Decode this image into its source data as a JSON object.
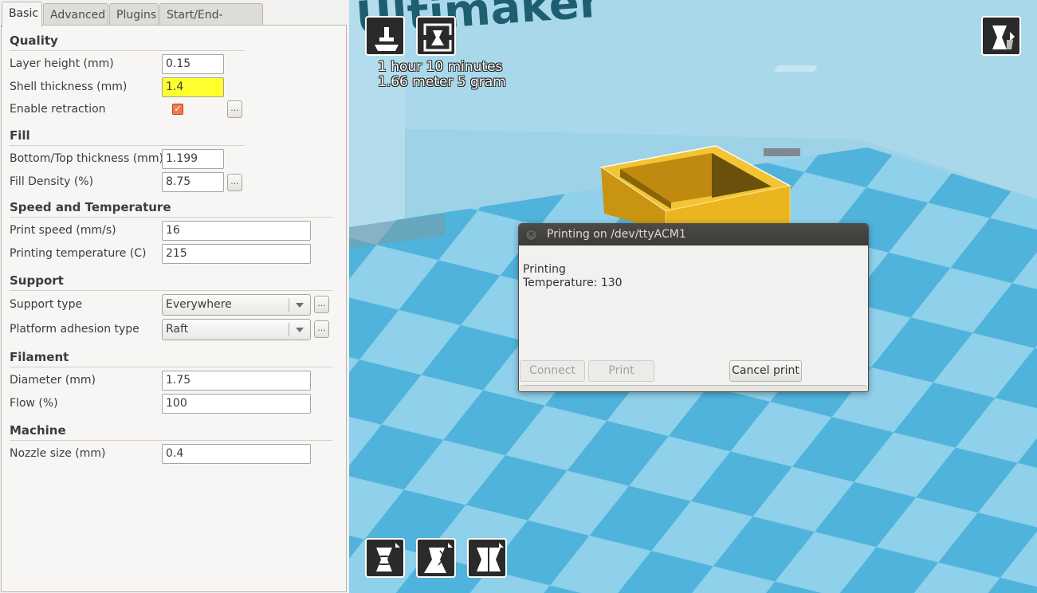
{
  "tabs": [
    "Basic",
    "Advanced",
    "Plugins",
    "Start/End-GCode"
  ],
  "quality": {
    "heading": "Quality",
    "layer_height_label": "Layer height (mm)",
    "layer_height": "0.15",
    "shell_label": "Shell thickness (mm)",
    "shell": "1.4",
    "retraction_label": "Enable retraction",
    "retraction_checked": true
  },
  "fill": {
    "heading": "Fill",
    "bottom_top_label": "Bottom/Top thickness (mm)",
    "bottom_top": "1.199",
    "density_label": "Fill Density (%)",
    "density": "8.75"
  },
  "speed": {
    "heading": "Speed and Temperature",
    "print_speed_label": "Print speed (mm/s)",
    "print_speed": "16",
    "temp_label": "Printing temperature (C)",
    "temp": "215"
  },
  "support": {
    "heading": "Support",
    "type_label": "Support type",
    "type": "Everywhere",
    "adhesion_label": "Platform adhesion type",
    "adhesion": "Raft"
  },
  "filament": {
    "heading": "Filament",
    "diameter_label": "Diameter (mm)",
    "diameter": "1.75",
    "flow_label": "Flow (%)",
    "flow": "100"
  },
  "machine": {
    "heading": "Machine",
    "nozzle_label": "Nozzle size (mm)",
    "nozzle": "0.4"
  },
  "dots_label": "...",
  "viewport": {
    "logo_text": "Ultimaker",
    "estimate_time": "1 hour 10 minutes",
    "estimate_material": "1.66 meter 5 gram",
    "colors": {
      "plate_light": "#8fd0ea",
      "plate_dark": "#4fb3dc",
      "object": "#eab51f",
      "wall": "#a9d8ea"
    }
  },
  "dialog": {
    "title": "Printing on /dev/ttyACM1",
    "status": "Printing",
    "temperature": "Temperature: 130",
    "connect": "Connect",
    "print": "Print",
    "cancel": "Cancel print"
  }
}
